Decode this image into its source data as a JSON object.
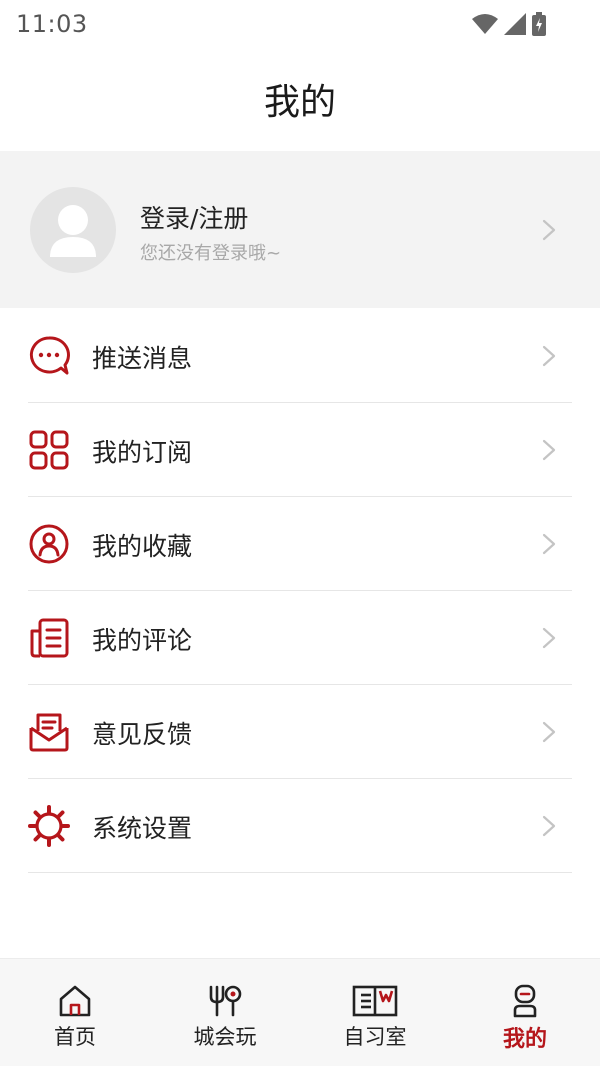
{
  "status_bar": {
    "time": "11:03"
  },
  "header": {
    "title": "我的"
  },
  "profile": {
    "name": "登录/注册",
    "subtitle": "您还没有登录哦~"
  },
  "menu": {
    "items": [
      {
        "label": "推送消息",
        "icon": "chat-bubble-icon"
      },
      {
        "label": "我的订阅",
        "icon": "grid-icon"
      },
      {
        "label": "我的收藏",
        "icon": "person-circle-icon"
      },
      {
        "label": "我的评论",
        "icon": "document-icon"
      },
      {
        "label": "意见反馈",
        "icon": "mail-icon"
      },
      {
        "label": "系统设置",
        "icon": "gear-icon"
      }
    ]
  },
  "tabs": [
    {
      "label": "首页",
      "icon": "home-icon",
      "active": false
    },
    {
      "label": "城会玩",
      "icon": "fork-spoon-icon",
      "active": false
    },
    {
      "label": "自习室",
      "icon": "book-icon",
      "active": false
    },
    {
      "label": "我的",
      "icon": "profile-icon",
      "active": true
    }
  ],
  "colors": {
    "accent": "#b5161b",
    "profile_bg": "#f3f3f3",
    "tab_bg": "#f7f7f7"
  }
}
